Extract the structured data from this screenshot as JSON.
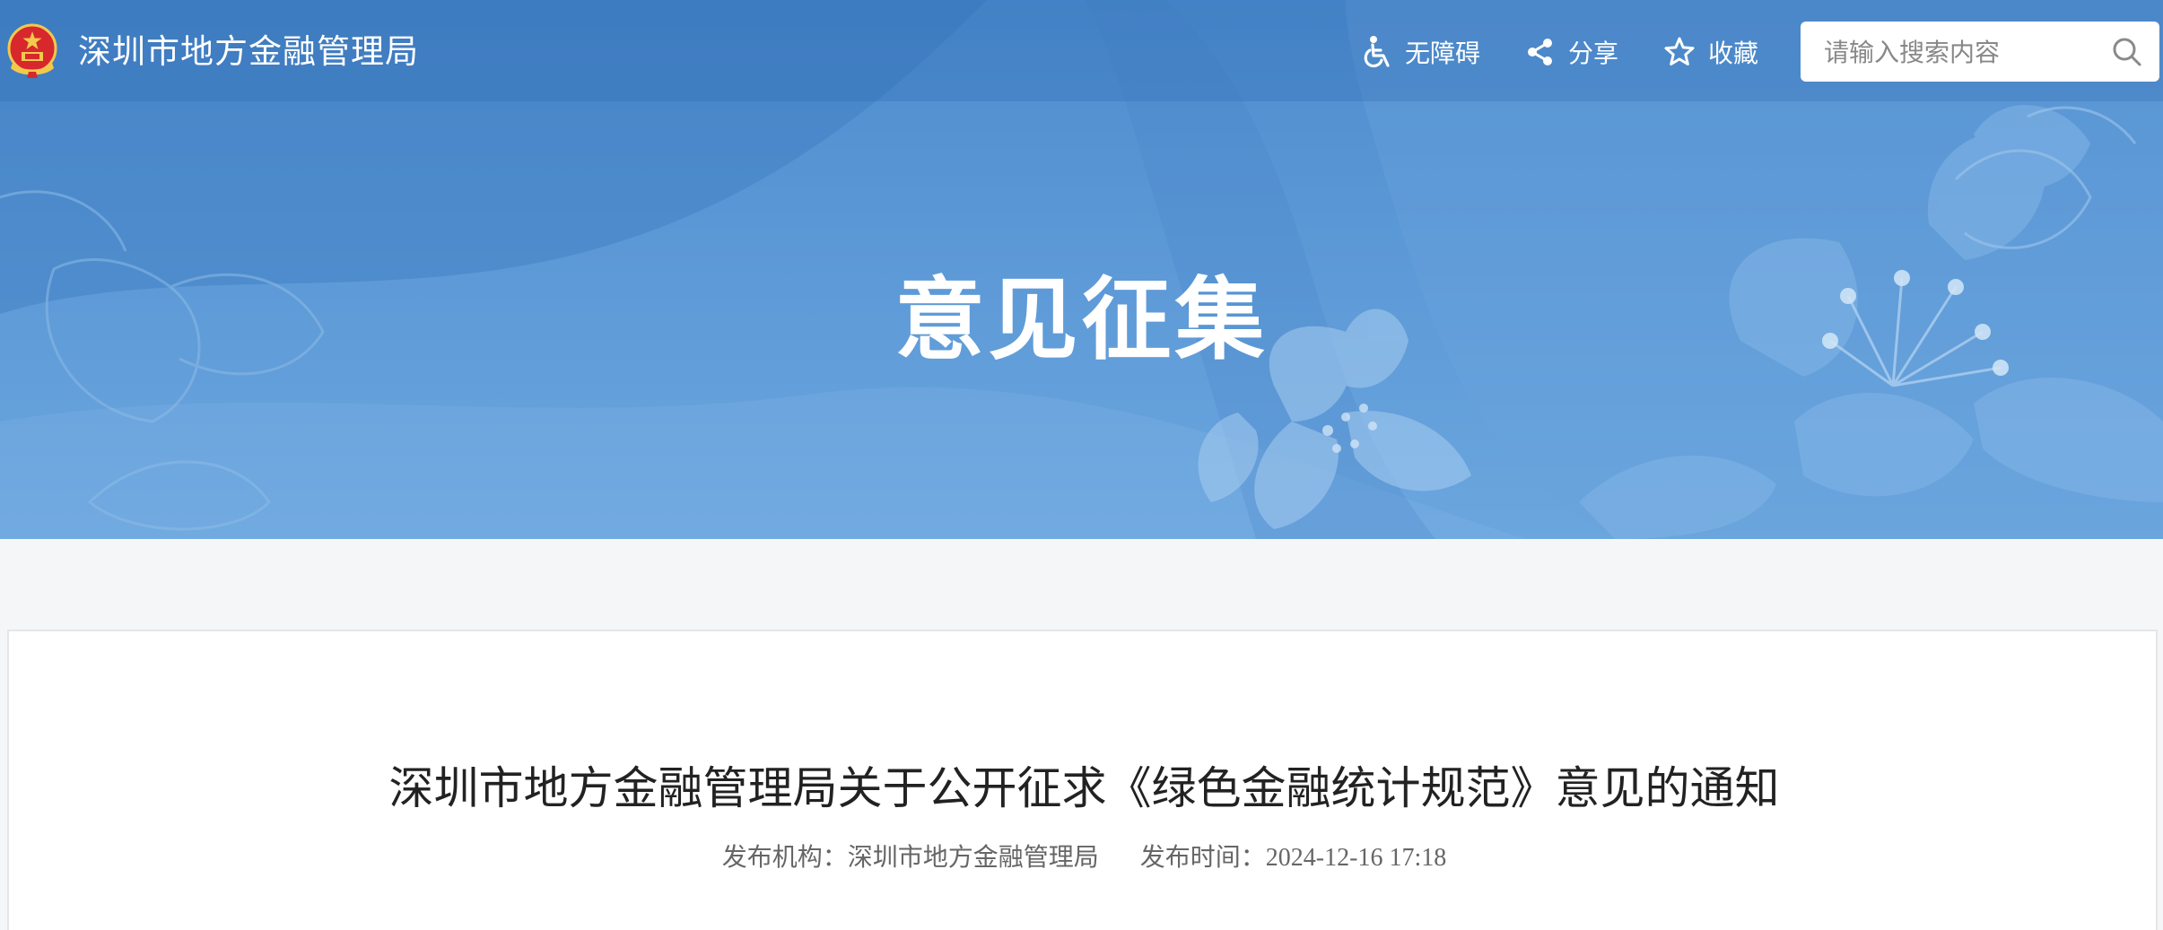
{
  "header": {
    "site_name": "深圳市地方金融管理局",
    "emblem_icon": "national-emblem-icon",
    "tools": {
      "accessibility": {
        "label": "无障碍",
        "icon": "wheelchair-icon"
      },
      "share": {
        "label": "分享",
        "icon": "share-icon"
      },
      "favorite": {
        "label": "收藏",
        "icon": "star-icon"
      }
    },
    "search": {
      "placeholder": "请输入搜索内容",
      "icon": "search-icon"
    }
  },
  "banner": {
    "title": "意见征集"
  },
  "article": {
    "title": "深圳市地方金融管理局关于公开征求《绿色金融统计规范》意见的通知",
    "publisher_label": "发布机构：",
    "publisher": "深圳市地方金融管理局",
    "time_label": "发布时间：",
    "time": "2024-12-16 17:18"
  },
  "colors": {
    "banner_blue": "#5b98d6",
    "page_bg": "#f5f6f7",
    "title_text": "#222222",
    "meta_text": "#666666"
  }
}
